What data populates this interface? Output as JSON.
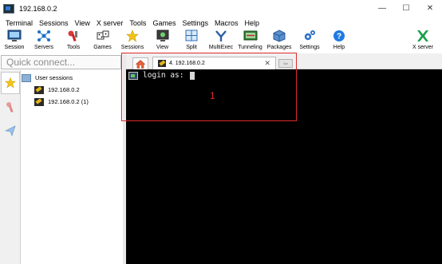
{
  "window": {
    "title": "192.168.0.2",
    "minimize_glyph": "—",
    "maximize_glyph": "☐",
    "close_glyph": "✕"
  },
  "menu": {
    "items": [
      "Terminal",
      "Sessions",
      "View",
      "X server",
      "Tools",
      "Games",
      "Settings",
      "Macros",
      "Help"
    ]
  },
  "toolbar": {
    "items": [
      {
        "label": "Session",
        "icon": "session-icon"
      },
      {
        "label": "Servers",
        "icon": "servers-icon"
      },
      {
        "label": "Tools",
        "icon": "tools-icon"
      },
      {
        "label": "Games",
        "icon": "games-icon"
      },
      {
        "label": "Sessions",
        "icon": "sessions-star-icon"
      },
      {
        "label": "View",
        "icon": "view-icon"
      },
      {
        "label": "Split",
        "icon": "split-icon"
      },
      {
        "label": "MultiExec",
        "icon": "multiexec-icon"
      },
      {
        "label": "Tunneling",
        "icon": "tunneling-icon"
      },
      {
        "label": "Packages",
        "icon": "packages-icon"
      },
      {
        "label": "Settings",
        "icon": "settings-gears-icon"
      },
      {
        "label": "Help",
        "icon": "help-icon"
      },
      {
        "label": "X server",
        "icon": "x-server-icon"
      }
    ]
  },
  "quick_connect": {
    "placeholder": "Quick connect..."
  },
  "sidebar": {
    "tabs": [
      "sessions-star-icon",
      "tools-icon",
      "macros-icon"
    ],
    "tree": {
      "root": "User sessions",
      "sessions": [
        "192.168.0.2",
        "192.168.0.2 (1)"
      ]
    }
  },
  "tabs": {
    "home_icon": "home-icon",
    "active": {
      "label": "4. 192.168.0.2",
      "close_glyph": "✕"
    },
    "new_tab_glyph": "⇦"
  },
  "terminal": {
    "prompt": "login as: "
  },
  "annotation": {
    "number": "1"
  },
  "colors": {
    "terminal_bg": "#000000",
    "annotation_red": "#e12a2a",
    "toolbar_blue": "#2d7ad6"
  }
}
